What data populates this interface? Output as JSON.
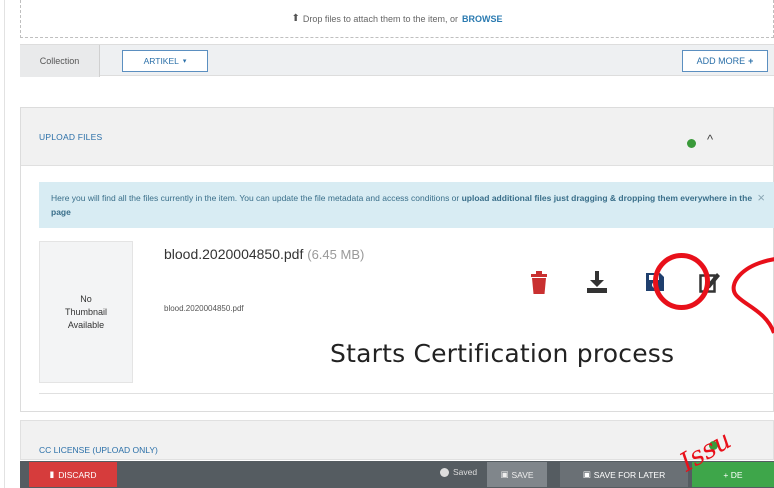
{
  "dropzone": {
    "text": "Drop files to attach them to the item, or",
    "browse": "BROWSE"
  },
  "collection": {
    "label": "Collection",
    "selected": "ARTIKEL",
    "add_more": "ADD MORE"
  },
  "upload_panel": {
    "title": "UPLOAD FILES",
    "alert_text": "Here you will find all the files currently in the item. You can update the file metadata and access conditions or",
    "alert_bold": "upload additional files just dragging & dropping them everywhere in the page",
    "alert_close": "×"
  },
  "file": {
    "thumb_line1": "No",
    "thumb_line2": "Thumbnail",
    "thumb_line3": "Available",
    "name": "blood.2020004850.pdf",
    "size": "(6.45 MB)",
    "name_small": "blood.2020004850.pdf"
  },
  "annotation": {
    "text": "Starts Certification process",
    "issue_text": "Issu",
    "color": "#e8101a"
  },
  "cc_panel": {
    "title": "CC LICENSE (UPLOAD ONLY)"
  },
  "toolbar": {
    "discard": "DISCARD",
    "saved": "Saved",
    "save": "SAVE",
    "save_later": "SAVE FOR LATER",
    "deposit": "+ DE"
  },
  "colors": {
    "accent": "#2a6fa8",
    "danger": "#d63c3c",
    "success": "#3ea64a",
    "alert_bg": "#d8ecf3"
  }
}
